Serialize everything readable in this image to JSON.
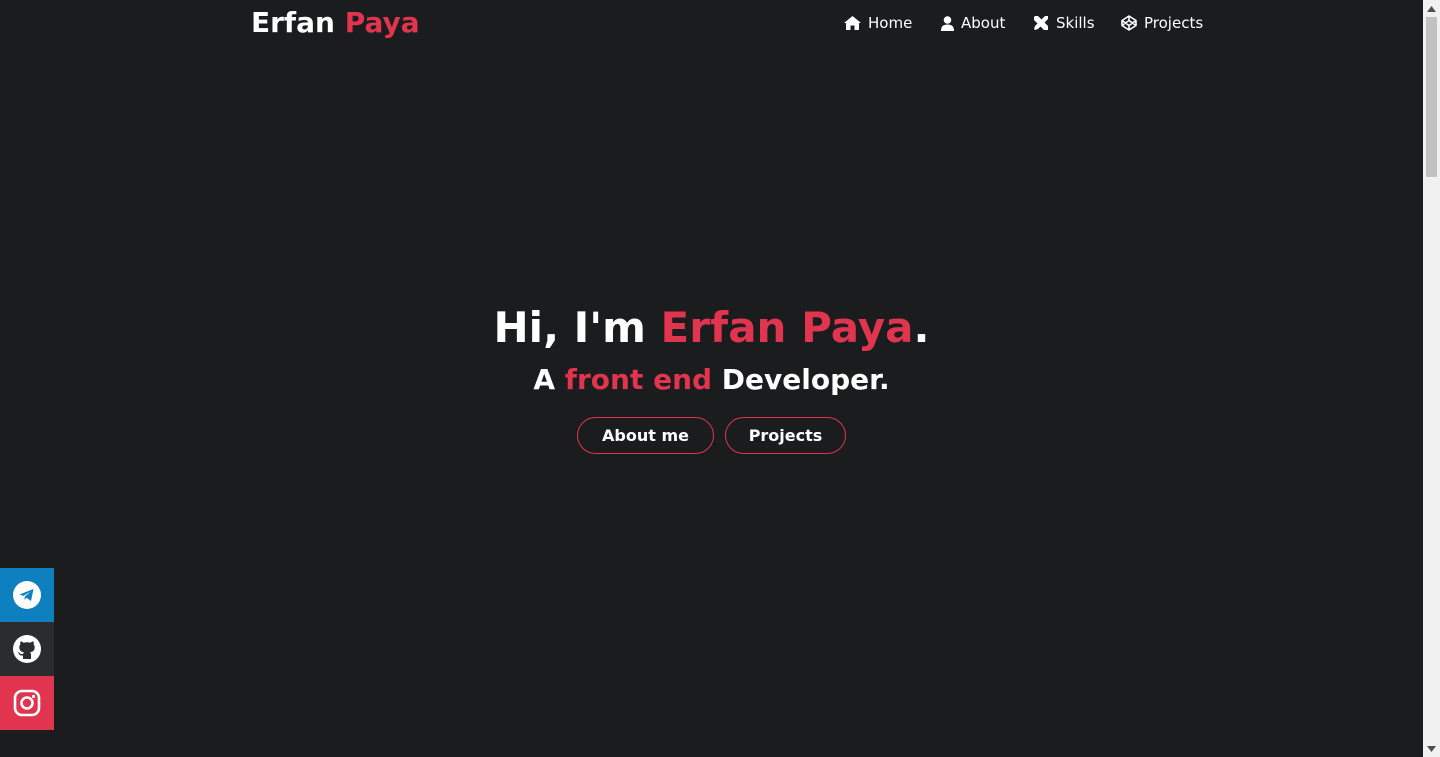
{
  "header": {
    "brand_first": "Erfan",
    "brand_last": "Paya",
    "nav": [
      {
        "label": "Home",
        "icon": "home-icon"
      },
      {
        "label": "About",
        "icon": "user-icon"
      },
      {
        "label": "Skills",
        "icon": "tools-icon"
      },
      {
        "label": "Projects",
        "icon": "codepen-icon"
      }
    ]
  },
  "hero": {
    "title_prefix": "Hi, I'm ",
    "title_name": "Erfan Paya",
    "title_suffix": ".",
    "sub_prefix": "A ",
    "sub_accent": "front end",
    "sub_suffix": " Developer.",
    "buttons": {
      "about": "About me",
      "projects": "Projects"
    }
  },
  "social": [
    {
      "name": "telegram",
      "icon": "telegram-icon",
      "color": "#0e7fbf"
    },
    {
      "name": "github",
      "icon": "github-icon",
      "color": "#2b2c2e"
    },
    {
      "name": "instagram",
      "icon": "instagram-icon",
      "color": "#e0344f"
    }
  ],
  "colors": {
    "background": "#1b1c1e",
    "accent": "#e0344f",
    "text": "#ffffff"
  }
}
